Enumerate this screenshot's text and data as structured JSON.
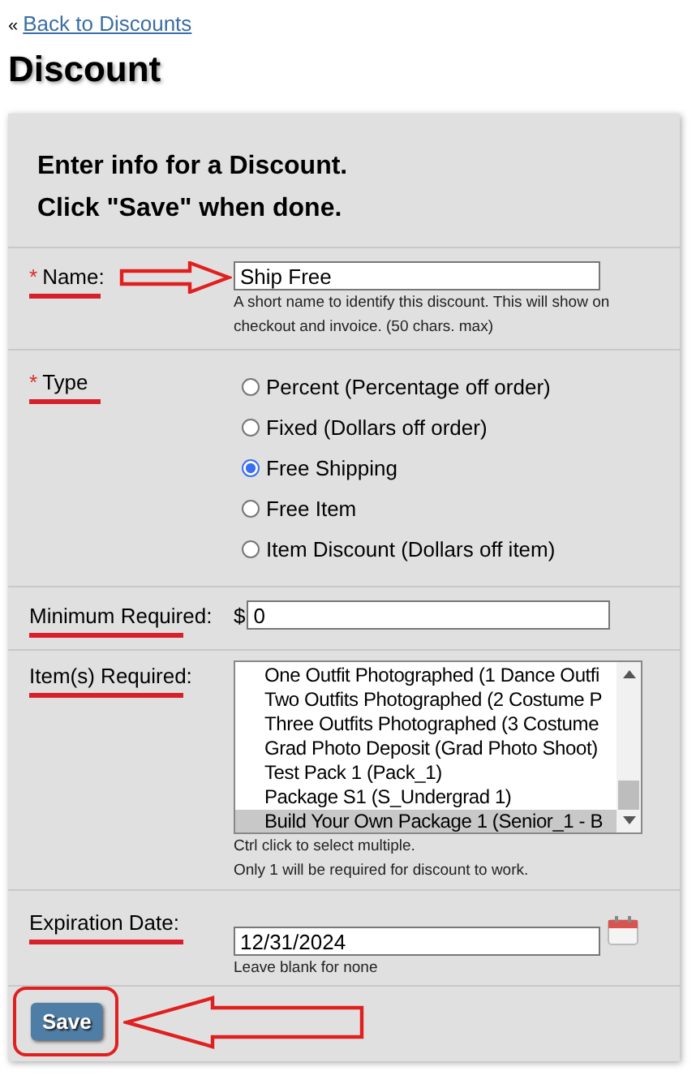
{
  "back_link": {
    "prefix": "«",
    "label": "Back to Discounts"
  },
  "heading": "Discount",
  "form": {
    "intro": [
      "Enter info for a Discount.",
      "Click \"Save\" when done."
    ],
    "fields": [
      {
        "kind": "text",
        "marker": "*",
        "label": "Name:",
        "value": "Ship Free",
        "help": [
          "A short name to identify this discount. This will show on checkout and invoice. (50 chars. max)"
        ]
      },
      {
        "kind": "radio",
        "marker": "*",
        "label": "Type",
        "options": [
          {
            "label": "Percent (Percentage off order)",
            "selected": false
          },
          {
            "label": "Fixed (Dollars off order)",
            "selected": false
          },
          {
            "label": "Free Shipping",
            "selected": true
          },
          {
            "label": "Free Item",
            "selected": false
          },
          {
            "label": "Item Discount (Dollars off item)",
            "selected": false
          }
        ]
      },
      {
        "kind": "money",
        "label": "Minimum Required:",
        "prefix": "$",
        "value": "0"
      },
      {
        "kind": "listbox",
        "label": "Item(s) Required:",
        "options": [
          {
            "label": "One Outfit Photographed (1 Dance Outfi",
            "selected": false
          },
          {
            "label": "Two Outfits Photographed (2 Costume P",
            "selected": false
          },
          {
            "label": "Three Outfits Photographed (3 Costume",
            "selected": false
          },
          {
            "label": "Grad Photo Deposit (Grad Photo Shoot)",
            "selected": false
          },
          {
            "label": "Test Pack 1 (Pack_1)",
            "selected": false
          },
          {
            "label": "Package S1 (S_Undergrad 1)",
            "selected": false
          },
          {
            "label": "Build Your Own Package 1 (Senior_1 - B",
            "selected": true
          }
        ],
        "help": [
          "Ctrl click to select multiple.",
          "Only 1 will be required for discount to work."
        ]
      },
      {
        "kind": "date",
        "label": "Expiration Date:",
        "value": "12/31/2024",
        "help": [
          "Leave blank for none"
        ]
      }
    ],
    "save_button": "Save"
  }
}
